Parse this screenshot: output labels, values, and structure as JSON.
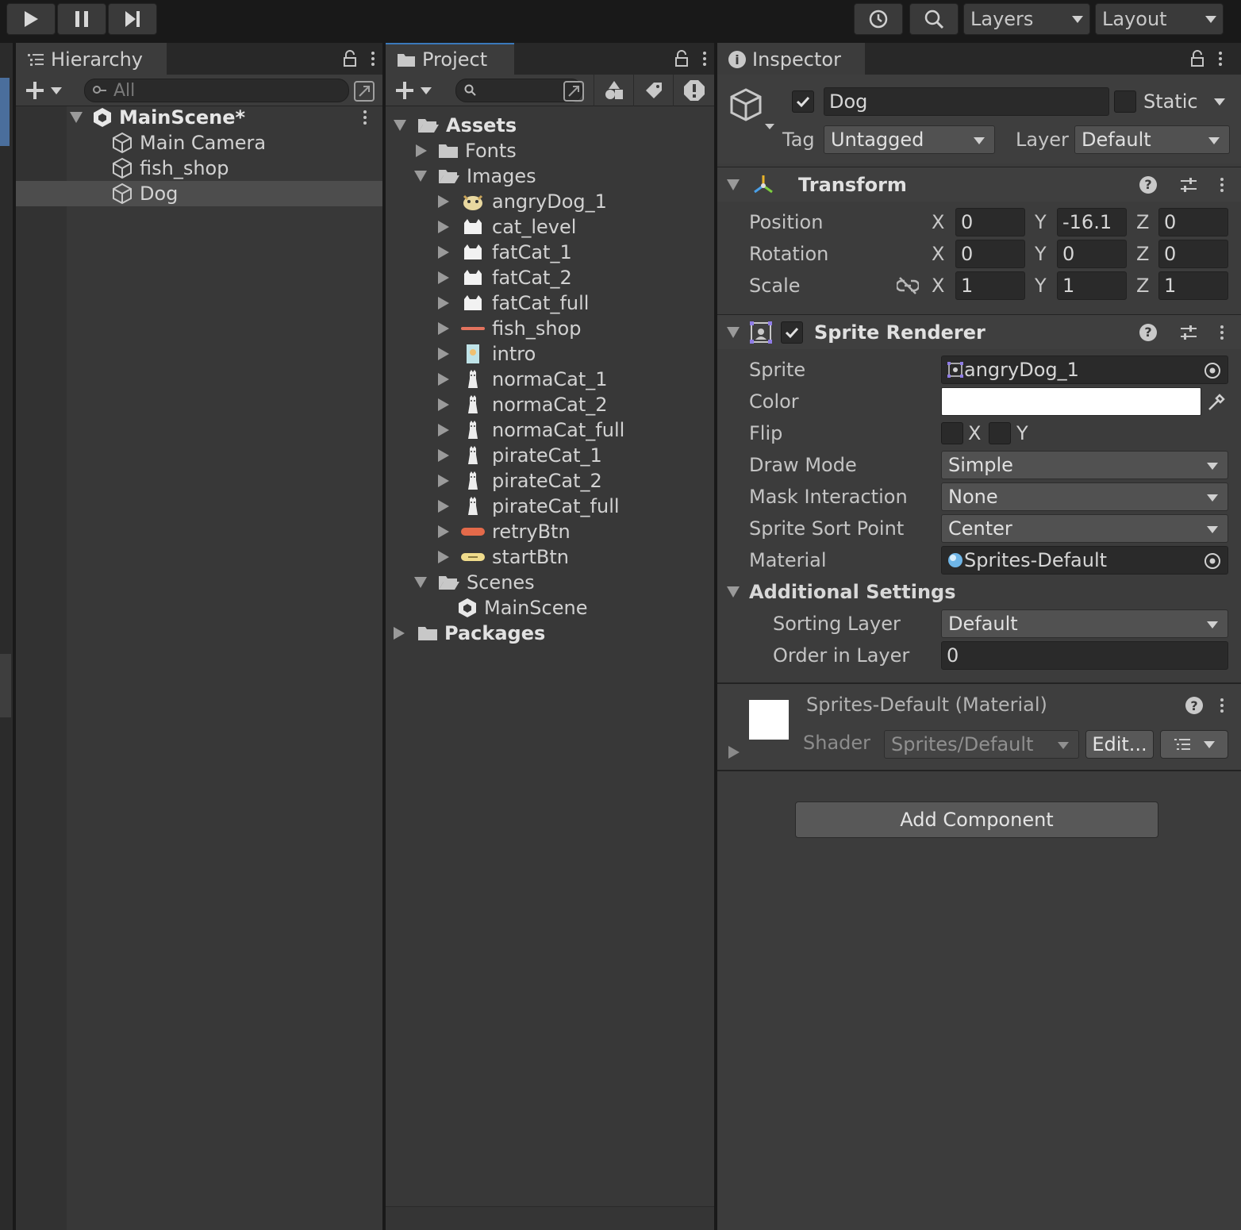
{
  "toolbar": {
    "layers_label": "Layers",
    "layout_label": "Layout"
  },
  "hierarchy": {
    "tab_label": "Hierarchy",
    "search_placeholder": "All",
    "scene": "MainScene*",
    "items": [
      "Main Camera",
      "fish_shop",
      "Dog"
    ],
    "selected": "Dog"
  },
  "project": {
    "tab_label": "Project",
    "assets": "Assets",
    "fonts": "Fonts",
    "images": "Images",
    "image_items": [
      "angryDog_1",
      "cat_level",
      "fatCat_1",
      "fatCat_2",
      "fatCat_full",
      "fish_shop",
      "intro",
      "normaCat_1",
      "normaCat_2",
      "normaCat_full",
      "pirateCat_1",
      "pirateCat_2",
      "pirateCat_full",
      "retryBtn",
      "startBtn"
    ],
    "scenes": "Scenes",
    "scene_item": "MainScene",
    "packages": "Packages"
  },
  "inspector": {
    "tab_label": "Inspector",
    "object_name": "Dog",
    "static_label": "Static",
    "tag_label": "Tag",
    "tag_value": "Untagged",
    "layer_label": "Layer",
    "layer_value": "Default",
    "transform": {
      "title": "Transform",
      "position_label": "Position",
      "rotation_label": "Rotation",
      "scale_label": "Scale",
      "axis_x": "X",
      "axis_y": "Y",
      "axis_z": "Z",
      "position": {
        "x": "0",
        "y": "-16.1",
        "z": "0"
      },
      "rotation": {
        "x": "0",
        "y": "0",
        "z": "0"
      },
      "scale": {
        "x": "1",
        "y": "1",
        "z": "1"
      }
    },
    "sprite_renderer": {
      "title": "Sprite Renderer",
      "sprite_label": "Sprite",
      "sprite_value": "angryDog_1",
      "color_label": "Color",
      "color_value": "#ffffff",
      "flip_label": "Flip",
      "flip_x": "X",
      "flip_y": "Y",
      "draw_mode_label": "Draw Mode",
      "draw_mode_value": "Simple",
      "mask_label": "Mask Interaction",
      "mask_value": "None",
      "sort_point_label": "Sprite Sort Point",
      "sort_point_value": "Center",
      "material_label": "Material",
      "material_value": "Sprites-Default",
      "additional_label": "Additional Settings",
      "sorting_layer_label": "Sorting Layer",
      "sorting_layer_value": "Default",
      "order_label": "Order in Layer",
      "order_value": "0"
    },
    "material": {
      "title": "Sprites-Default (Material)",
      "shader_label": "Shader",
      "shader_value": "Sprites/Default",
      "edit_label": "Edit..."
    },
    "add_component": "Add Component"
  }
}
